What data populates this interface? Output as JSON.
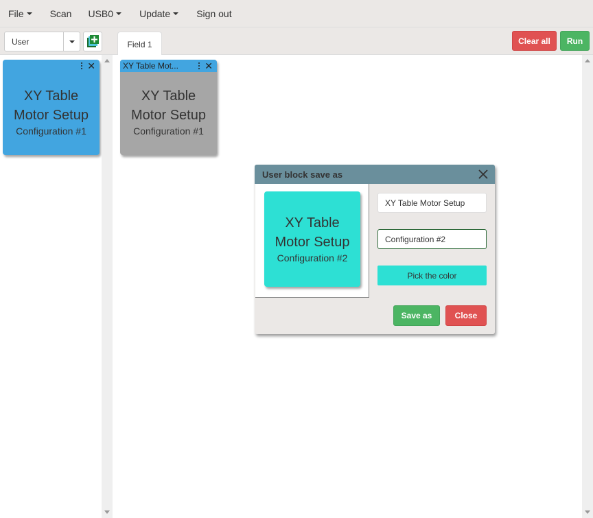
{
  "menu": {
    "items": [
      {
        "label": "File",
        "dropdown": true
      },
      {
        "label": "Scan",
        "dropdown": false
      },
      {
        "label": "USB0",
        "dropdown": true
      },
      {
        "label": "Update",
        "dropdown": true
      },
      {
        "label": "Sign out",
        "dropdown": false
      }
    ]
  },
  "toolbar": {
    "category_select": "User",
    "add_block_icon": "add-block-icon",
    "tab_label": "Field 1",
    "clear_all_label": "Clear all",
    "run_label": "Run"
  },
  "sidebar": {
    "blocks": [
      {
        "title": "XY Table Motor Setup",
        "title_line1": "XY Table",
        "title_line2": "Motor Setup",
        "subtitle": "Configuration #1",
        "color": "#42a5e0"
      }
    ]
  },
  "workspace": {
    "blocks": [
      {
        "header": "XY Table Mot...",
        "title_line1": "XY Table",
        "title_line2": "Motor Setup",
        "subtitle": "Configuration #1",
        "header_color": "#42a5e0",
        "body_color": "#a6a6a6"
      }
    ]
  },
  "dialog": {
    "title": "User block save as",
    "preview": {
      "title_line1": "XY Table",
      "title_line2": "Motor Setup",
      "subtitle": "Configuration #2",
      "color": "#2de0d4"
    },
    "name_value": "XY Table Motor Setup",
    "subtitle_value": "Configuration #2",
    "pick_color_label": "Pick the color",
    "save_as_label": "Save as",
    "close_label": "Close"
  },
  "colors": {
    "danger": "#e05252",
    "success": "#4cb563",
    "dialog_header": "#6a8f9c"
  }
}
